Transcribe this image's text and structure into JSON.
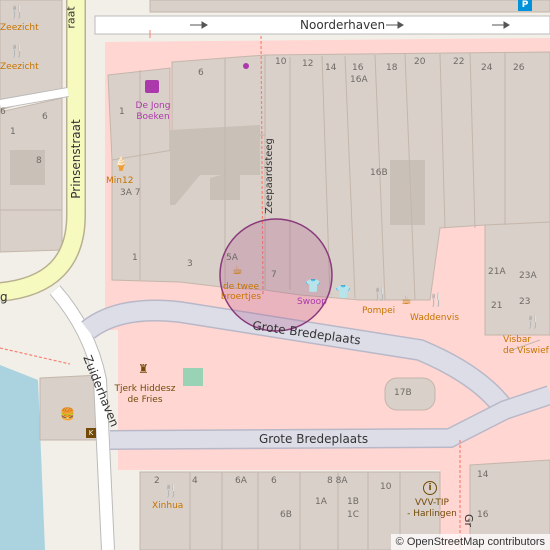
{
  "streets": {
    "noorderhaven": "Noorderhaven",
    "prinsenstraat": "Prinsenstraat",
    "zeepaardsteeg": "Zeepaardsteeg",
    "zuiderhaven": "Zuiderhaven",
    "grote_bredeplaats_1": "Grote Bredeplaats",
    "grote_bredeplaats_2": "Grote Bredeplaats",
    "partial_straat": "raat",
    "partial_g": "g",
    "partial_gr": "Gr"
  },
  "house_numbers": {
    "n6a": "6",
    "n12a": "1",
    "n6b": "6",
    "n8": "8",
    "n6top": "6",
    "n10": "10",
    "n12": "12",
    "n14": "14",
    "n16": "16",
    "n16a": "16A",
    "n18": "18",
    "n20": "20",
    "n22": "22",
    "n24": "24",
    "n26": "26",
    "n1": "1",
    "n3a7": "3A 7",
    "n16b": "16B",
    "n1b": "1",
    "n3": "3",
    "n5a": "5A",
    "n7": "7",
    "n21a": "21A",
    "n23a": "23A",
    "n21": "21",
    "n23": "23",
    "n17b": "17B",
    "n2": "2",
    "n4": "4",
    "n6ab": "6A",
    "n6c": "6",
    "n8_8a": "8 8A",
    "n10b": "10",
    "n14b": "14",
    "n6b2": "6B",
    "n1a": "1A",
    "n1b2": "1B",
    "n1c": "1C",
    "n16c": "16"
  },
  "pois": {
    "zeezicht_1": "Zeezicht",
    "zeezicht_2": "Zeezicht",
    "de_jong_boeken": "De Jong\nBoeken",
    "min12": "Min12",
    "de_twee_broertjes": "de twee\nbroertjes",
    "swoop": "Swoop",
    "pompei": "Pompei",
    "waddenvis": "Waddenvis",
    "visbar": "Visbar\nde Viswief",
    "tjerk": "Tjerk Hiddesz\nde Fries",
    "xinhua": "Xinhua",
    "vvv": "VVV-TIP\n- Harlingen"
  },
  "parking_label": "P",
  "attribution": {
    "symbol": "©",
    "text": "OpenStreetMap contributors"
  },
  "colors": {
    "background": "#f2efe9",
    "building": "#d9d0c9",
    "pedestrian": "#dddde8",
    "water": "#aad3df",
    "primary_road": "#f7fabf",
    "retail": "#ffd6d1",
    "highlight_circle": "#b05c8c"
  },
  "icons": [
    "book-icon",
    "ice-cream-icon",
    "cafe-icon",
    "clothes-icon",
    "restaurant-icon",
    "monument-icon",
    "fast-food-icon",
    "info-icon",
    "parking-icon"
  ]
}
